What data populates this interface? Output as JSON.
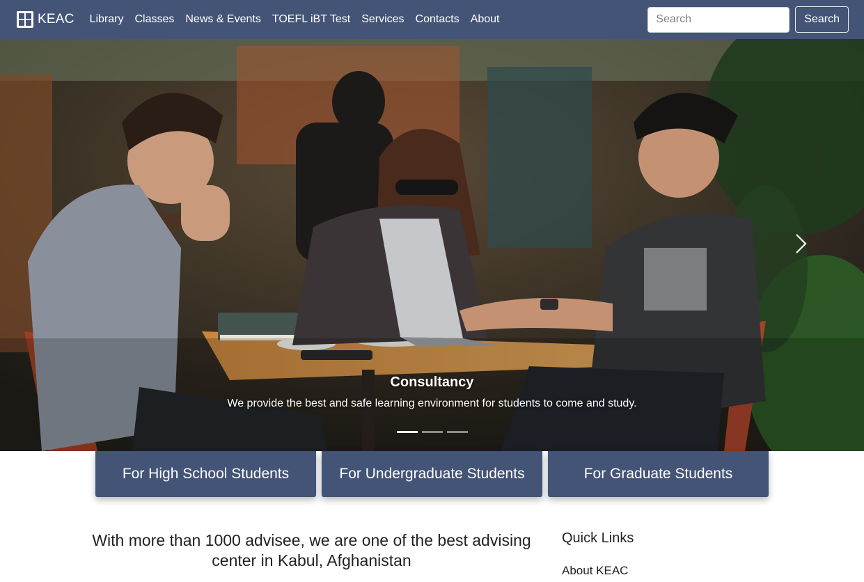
{
  "nav": {
    "brand": "KEAC",
    "links": [
      "Library",
      "Classes",
      "News & Events",
      "TOEFL iBT Test",
      "Services",
      "Contacts",
      "About"
    ],
    "search_placeholder": "Search",
    "search_button": "Search"
  },
  "hero": {
    "caption_title": "Consultancy",
    "caption_text": "We provide the best and safe learning environment for students to come and study.",
    "slide_count": 3,
    "active_slide": 1
  },
  "categories": [
    "For High School Students",
    "For Undergraduate Students",
    "For Graduate Students"
  ],
  "intro": {
    "heading": "With more than 1000 advisee, we are one of the best advising center in Kabul, Afghanistan"
  },
  "quick_links": {
    "title": "Quick Links",
    "items": [
      "About KEAC"
    ]
  },
  "colors": {
    "primary": "#445477",
    "text": "#222222",
    "white": "#ffffff"
  },
  "icons": {
    "brand": "keac-logo-icon",
    "carousel_next": "chevron-right-icon"
  }
}
